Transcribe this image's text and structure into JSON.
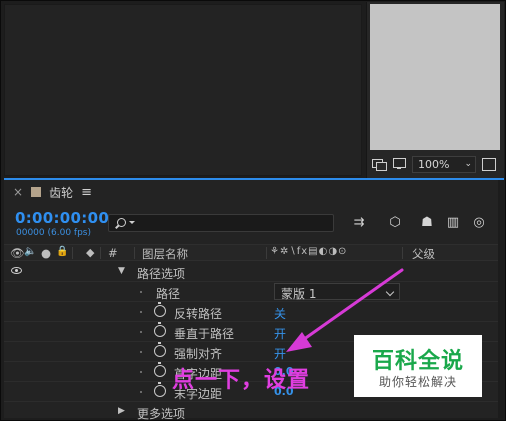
{
  "viewer": {
    "zoom": "100%"
  },
  "timeline": {
    "tab_close": "×",
    "tab_title": "齿轮",
    "tab_menu": "≡",
    "timecode": "0:00:00:00",
    "frames_fps": "00000 (6.00 fps)",
    "columns": {
      "hash": "#",
      "layer_name": "图层名称",
      "parent": "父级"
    },
    "rows": {
      "path_options": "路径选项",
      "path": "路径",
      "path_value": "蒙版 1",
      "reverse_path": "反转路径",
      "reverse_path_value": "关",
      "perpendicular": "垂直于路径",
      "perpendicular_value": "开",
      "force_align": "强制对齐",
      "force_align_value": "开",
      "first_margin": "首字边距",
      "first_margin_value": "0.0",
      "last_margin": "末字边距",
      "last_margin_value": "0.0",
      "more_options": "更多选项"
    }
  },
  "annotation": {
    "text": "点一下，设置",
    "color": "#e03ee0"
  },
  "watermark": {
    "title": "百科全说",
    "subtitle": "助你轻松解决"
  },
  "colors": {
    "accent_blue": "#2f8ff0",
    "background": "#232323"
  }
}
